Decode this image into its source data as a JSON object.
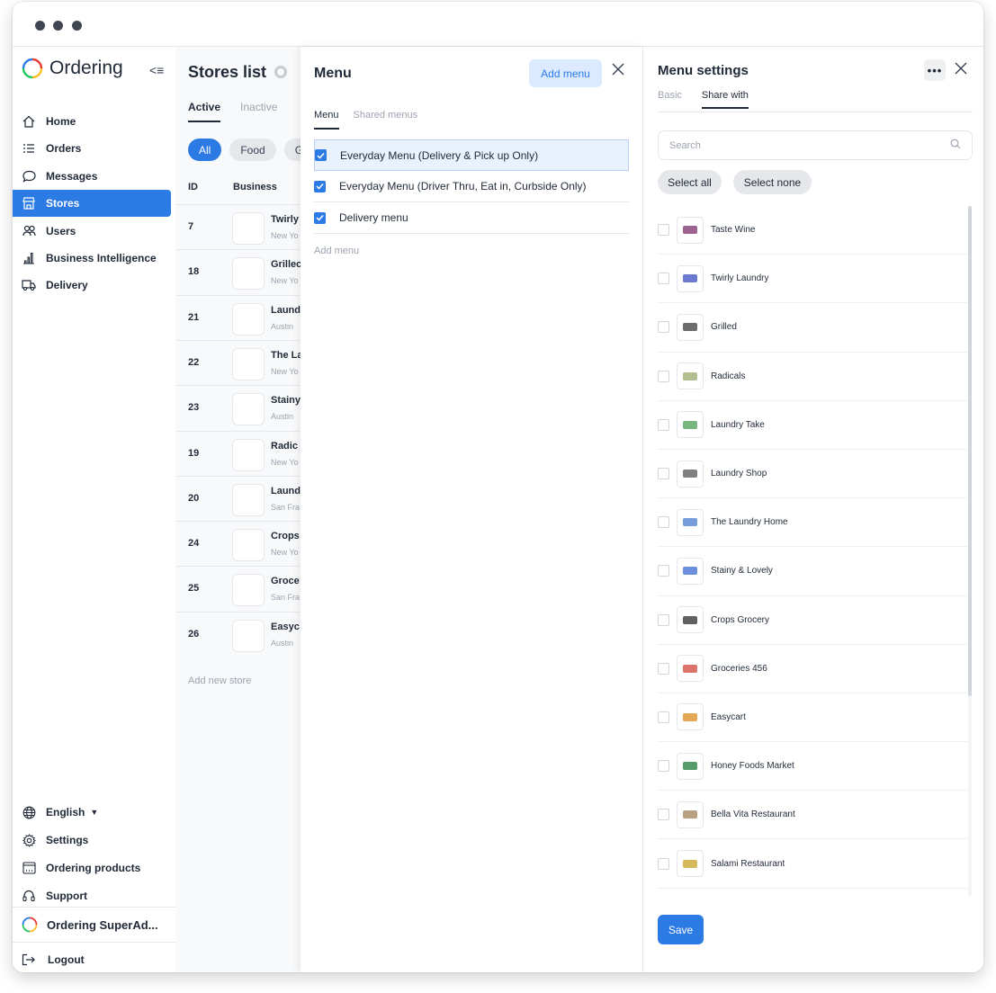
{
  "app": {
    "logo_text": "Ordering"
  },
  "sidebar": {
    "items": [
      {
        "label": "Home",
        "icon": "home-icon"
      },
      {
        "label": "Orders",
        "icon": "list-icon"
      },
      {
        "label": "Messages",
        "icon": "chat-icon"
      },
      {
        "label": "Stores",
        "icon": "store-icon",
        "active": true
      },
      {
        "label": "Users",
        "icon": "users-icon"
      },
      {
        "label": "Business Intelligence",
        "icon": "bar-chart-icon"
      },
      {
        "label": "Delivery",
        "icon": "truck-icon"
      }
    ],
    "bottom": [
      {
        "label": "English",
        "icon": "globe-icon"
      },
      {
        "label": "Settings",
        "icon": "gear-icon"
      },
      {
        "label": "Ordering products",
        "icon": "window-icon"
      },
      {
        "label": "Support",
        "icon": "headset-icon"
      }
    ],
    "user": "Ordering SuperAd...",
    "logout": "Logout"
  },
  "stores": {
    "title": "Stores list",
    "tabs": [
      "Active",
      "Inactive"
    ],
    "chips": [
      "All",
      "Food",
      "G"
    ],
    "columns": {
      "id": "ID",
      "business": "Business"
    },
    "rows": [
      {
        "id": "7",
        "name": "Twirly",
        "city": "New Yo"
      },
      {
        "id": "18",
        "name": "Grillec",
        "city": "New Yo"
      },
      {
        "id": "21",
        "name": "Laund",
        "city": "Austin"
      },
      {
        "id": "22",
        "name": "The La",
        "city": "New Yo"
      },
      {
        "id": "23",
        "name": "Stainy",
        "city": "Austin"
      },
      {
        "id": "19",
        "name": "Radic",
        "city": "New Yo"
      },
      {
        "id": "20",
        "name": "Laund",
        "city": "San Fra"
      },
      {
        "id": "24",
        "name": "Crops",
        "city": "New Yo"
      },
      {
        "id": "25",
        "name": "Groce",
        "city": "San Fra"
      },
      {
        "id": "26",
        "name": "Easyc",
        "city": "Austin"
      }
    ],
    "add_new": "Add new store"
  },
  "menu": {
    "title": "Menu",
    "add_button": "Add menu",
    "tabs": [
      "Menu",
      "Shared menus"
    ],
    "items": [
      "Everyday Menu (Delivery & Pick up Only)",
      "Everyday Menu (Driver Thru, Eat in, Curbside Only)",
      "Delivery menu"
    ],
    "add_link": "Add menu"
  },
  "settings": {
    "title": "Menu settings",
    "more": "•••",
    "tabs": [
      "Basic",
      "Share with"
    ],
    "search_placeholder": "Search",
    "select_all": "Select all",
    "select_none": "Select none",
    "businesses": [
      "Taste Wine",
      "Twirly Laundry",
      "Grilled",
      "Radicals",
      "Laundry Take",
      "Laundry Shop",
      "The Laundry Home",
      "Stainy & Lovely",
      "Crops Grocery",
      "Groceries 456",
      "Easycart",
      "Honey Foods Market",
      "Bella Vita Restaurant",
      "Salami Restaurant"
    ],
    "save": "Save"
  },
  "colors": {
    "accent": "#2c7be5"
  }
}
